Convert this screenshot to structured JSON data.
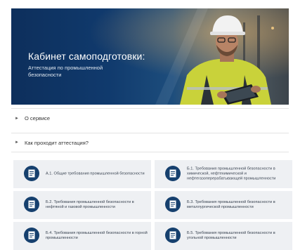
{
  "hero": {
    "title": "Кабинет самоподготовки:",
    "subtitle": "Аттестация по промышленной безопасности"
  },
  "accordion": [
    {
      "label": "О сервисе"
    },
    {
      "label": "Как проходит аттестация?"
    }
  ],
  "cards": [
    {
      "label": "А.1. Общие требования промышленной безопасности",
      "icon": "document-icon"
    },
    {
      "label": "Б.1. Требования промышленной безопасности в химической, нефтехимической и нефтегазоперерабатывающей промышленности",
      "icon": "document-icon"
    },
    {
      "label": "Б.2. Требования промышленной безопасности в нефтяной и газовой промышленности",
      "icon": "document-icon"
    },
    {
      "label": "Б.3. Требования промышленной безопасности в металлургической промышленности",
      "icon": "document-icon"
    },
    {
      "label": "Б.4. Требования промышленной безопасности в горной промышленности",
      "icon": "document-icon"
    },
    {
      "label": "Б.5. Требования промышленной безопасности в угольной промышленности",
      "icon": "document-icon"
    }
  ],
  "colors": {
    "brand_navy": "#16406e",
    "card_bg": "#eef0f3",
    "safety_yellow": "#d8e03a"
  }
}
